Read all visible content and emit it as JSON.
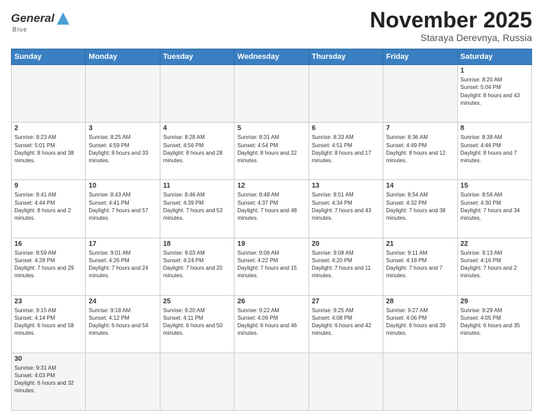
{
  "header": {
    "logo_general": "General",
    "logo_blue": "Blue",
    "title": "November 2025",
    "location": "Staraya Derevnya, Russia"
  },
  "days_of_week": [
    "Sunday",
    "Monday",
    "Tuesday",
    "Wednesday",
    "Thursday",
    "Friday",
    "Saturday"
  ],
  "weeks": [
    [
      {
        "day": "",
        "empty": true
      },
      {
        "day": "",
        "empty": true
      },
      {
        "day": "",
        "empty": true
      },
      {
        "day": "",
        "empty": true
      },
      {
        "day": "",
        "empty": true
      },
      {
        "day": "",
        "empty": true
      },
      {
        "day": "1",
        "sunrise": "8:20 AM",
        "sunset": "5:04 PM",
        "daylight": "8 hours and 43 minutes."
      }
    ],
    [
      {
        "day": "2",
        "sunrise": "8:23 AM",
        "sunset": "5:01 PM",
        "daylight": "8 hours and 38 minutes."
      },
      {
        "day": "3",
        "sunrise": "8:25 AM",
        "sunset": "4:59 PM",
        "daylight": "8 hours and 33 minutes."
      },
      {
        "day": "4",
        "sunrise": "8:28 AM",
        "sunset": "4:56 PM",
        "daylight": "8 hours and 28 minutes."
      },
      {
        "day": "5",
        "sunrise": "8:31 AM",
        "sunset": "4:54 PM",
        "daylight": "8 hours and 22 minutes."
      },
      {
        "day": "6",
        "sunrise": "8:33 AM",
        "sunset": "4:51 PM",
        "daylight": "8 hours and 17 minutes."
      },
      {
        "day": "7",
        "sunrise": "8:36 AM",
        "sunset": "4:49 PM",
        "daylight": "8 hours and 12 minutes."
      },
      {
        "day": "8",
        "sunrise": "8:38 AM",
        "sunset": "4:46 PM",
        "daylight": "8 hours and 7 minutes."
      }
    ],
    [
      {
        "day": "9",
        "sunrise": "8:41 AM",
        "sunset": "4:44 PM",
        "daylight": "8 hours and 2 minutes."
      },
      {
        "day": "10",
        "sunrise": "8:43 AM",
        "sunset": "4:41 PM",
        "daylight": "7 hours and 57 minutes."
      },
      {
        "day": "11",
        "sunrise": "8:46 AM",
        "sunset": "4:39 PM",
        "daylight": "7 hours and 53 minutes."
      },
      {
        "day": "12",
        "sunrise": "8:48 AM",
        "sunset": "4:37 PM",
        "daylight": "7 hours and 48 minutes."
      },
      {
        "day": "13",
        "sunrise": "8:51 AM",
        "sunset": "4:34 PM",
        "daylight": "7 hours and 43 minutes."
      },
      {
        "day": "14",
        "sunrise": "8:54 AM",
        "sunset": "4:32 PM",
        "daylight": "7 hours and 38 minutes."
      },
      {
        "day": "15",
        "sunrise": "8:56 AM",
        "sunset": "4:30 PM",
        "daylight": "7 hours and 34 minutes."
      }
    ],
    [
      {
        "day": "16",
        "sunrise": "8:59 AM",
        "sunset": "4:28 PM",
        "daylight": "7 hours and 29 minutes."
      },
      {
        "day": "17",
        "sunrise": "9:01 AM",
        "sunset": "4:26 PM",
        "daylight": "7 hours and 24 minutes."
      },
      {
        "day": "18",
        "sunrise": "9:03 AM",
        "sunset": "4:24 PM",
        "daylight": "7 hours and 20 minutes."
      },
      {
        "day": "19",
        "sunrise": "9:06 AM",
        "sunset": "4:22 PM",
        "daylight": "7 hours and 15 minutes."
      },
      {
        "day": "20",
        "sunrise": "9:08 AM",
        "sunset": "4:20 PM",
        "daylight": "7 hours and 11 minutes."
      },
      {
        "day": "21",
        "sunrise": "9:11 AM",
        "sunset": "4:18 PM",
        "daylight": "7 hours and 7 minutes."
      },
      {
        "day": "22",
        "sunrise": "9:13 AM",
        "sunset": "4:16 PM",
        "daylight": "7 hours and 2 minutes."
      }
    ],
    [
      {
        "day": "23",
        "sunrise": "9:15 AM",
        "sunset": "4:14 PM",
        "daylight": "6 hours and 58 minutes."
      },
      {
        "day": "24",
        "sunrise": "9:18 AM",
        "sunset": "4:12 PM",
        "daylight": "6 hours and 54 minutes."
      },
      {
        "day": "25",
        "sunrise": "9:20 AM",
        "sunset": "4:11 PM",
        "daylight": "6 hours and 50 minutes."
      },
      {
        "day": "26",
        "sunrise": "9:22 AM",
        "sunset": "4:09 PM",
        "daylight": "6 hours and 46 minutes."
      },
      {
        "day": "27",
        "sunrise": "9:25 AM",
        "sunset": "4:08 PM",
        "daylight": "6 hours and 42 minutes."
      },
      {
        "day": "28",
        "sunrise": "9:27 AM",
        "sunset": "4:06 PM",
        "daylight": "6 hours and 39 minutes."
      },
      {
        "day": "29",
        "sunrise": "9:29 AM",
        "sunset": "4:05 PM",
        "daylight": "6 hours and 35 minutes."
      }
    ],
    [
      {
        "day": "30",
        "sunrise": "9:31 AM",
        "sunset": "4:03 PM",
        "daylight": "6 hours and 32 minutes."
      },
      {
        "day": "",
        "empty": true
      },
      {
        "day": "",
        "empty": true
      },
      {
        "day": "",
        "empty": true
      },
      {
        "day": "",
        "empty": true
      },
      {
        "day": "",
        "empty": true
      },
      {
        "day": "",
        "empty": true
      }
    ]
  ]
}
